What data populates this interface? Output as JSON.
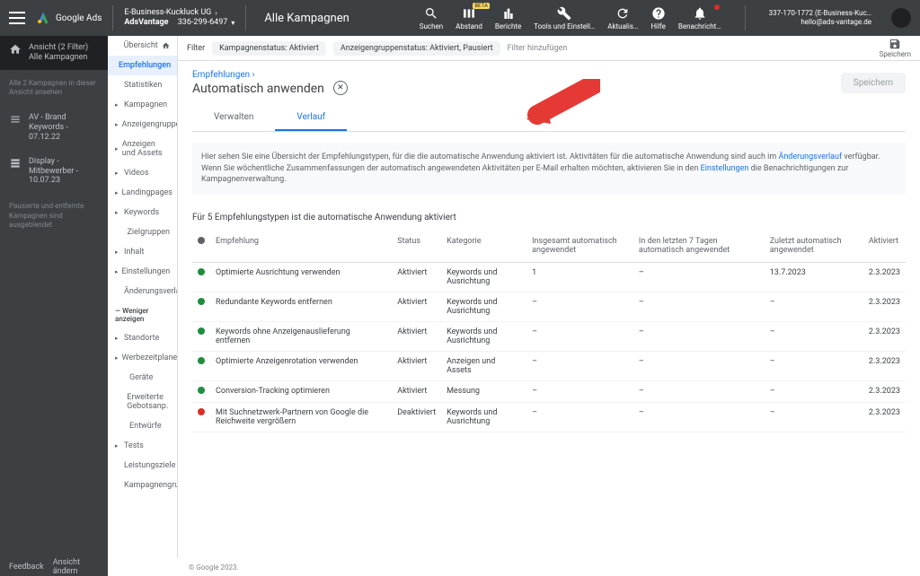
{
  "header": {
    "brand": "Google Ads",
    "account_line1": "E-Business-Kuckluck UG",
    "account_line2": "AdsVantage",
    "account_id": "336-299-6497",
    "campaign_title": "Alle Kampagnen",
    "icons": {
      "search": "Suchen",
      "distance": "Abstand",
      "reports": "Berichte",
      "tools": "Tools und Einstell…",
      "refresh": "Aktualis…",
      "help": "Hilfe",
      "notif": "Benachricht…"
    },
    "beta": "BETA",
    "account_right_line1": "337-170-1772 (E-Business-Kuc…",
    "account_right_line2": "hello@ads-vantage.de"
  },
  "sidebar1": {
    "view_title": "Ansicht (2 Filter)",
    "view_sub": "Alle Kampagnen",
    "view_note": "Alle 2 Kampagnen in dieser Ansicht ansehen",
    "items": [
      {
        "label": "AV - Brand Keywords - 07.12.22"
      },
      {
        "label": "Display - Mitbewerber - 10.07.23"
      }
    ],
    "paused_note": "Pausierte und entfernte Kampagnen sind ausgeblendet"
  },
  "sidebar2": {
    "items": [
      {
        "label": "Übersicht",
        "caret": false,
        "home": true
      },
      {
        "label": "Empfehlungen",
        "caret": false,
        "active": true
      },
      {
        "label": "Statistiken",
        "caret": false
      },
      {
        "label": "Kampagnen",
        "caret": true
      },
      {
        "label": "Anzeigengruppen",
        "caret": true
      },
      {
        "label": "Anzeigen und Assets",
        "caret": true
      },
      {
        "label": "Videos",
        "caret": true
      },
      {
        "label": "Landingpages",
        "caret": true
      },
      {
        "label": "Keywords",
        "caret": true
      },
      {
        "label": "Zielgruppen",
        "caret": false,
        "indent": true
      },
      {
        "label": "Inhalt",
        "caret": true
      },
      {
        "label": "Einstellungen",
        "caret": true
      },
      {
        "label": "Änderungsverlauf",
        "caret": false,
        "indent": true
      }
    ],
    "less": "Weniger anzeigen",
    "items2": [
      {
        "label": "Standorte",
        "caret": true
      },
      {
        "label": "Werbezeitplaner",
        "caret": true
      },
      {
        "label": "Geräte",
        "caret": false,
        "indent": true
      },
      {
        "label": "Erweiterte Gebotsanp.",
        "caret": false,
        "indent": true
      },
      {
        "label": "Entwürfe",
        "caret": false,
        "indent": true
      },
      {
        "label": "Tests",
        "caret": true
      },
      {
        "label": "Leistungsziele",
        "caret": false,
        "indent": true
      },
      {
        "label": "Kampagnengruppen",
        "caret": false,
        "indent": true
      }
    ]
  },
  "filterbar": {
    "label": "Filter",
    "chips": [
      "Kampagnenstatus: Aktiviert",
      "Anzeigengruppenstatus: Aktiviert, Pausiert"
    ],
    "add": "Filter hinzufügen",
    "save": "Speichern"
  },
  "page": {
    "breadcrumb": "Empfehlungen",
    "title": "Automatisch anwenden",
    "save_btn": "Speichern",
    "tabs": [
      "Verwalten",
      "Verlauf"
    ],
    "info_pre": "Hier sehen Sie eine Übersicht der Empfehlungstypen, für die die automatische Anwendung aktiviert ist. Aktivitäten für die automatische Anwendung sind auch im ",
    "info_link1": "Änderungsverlauf",
    "info_mid": " verfügbar. Wenn Sie wöchentliche Zusammenfassungen der automatisch angewendeten Aktivitäten per E-Mail erhalten möchten, aktivieren Sie in den ",
    "info_link2": "Einstellungen",
    "info_post": " die Benachrichtigungen zur Kampagnenverwaltung.",
    "subhead": "Für 5  Empfehlungstypen ist die automatische Anwendung aktiviert"
  },
  "table": {
    "headers": [
      "",
      "Empfehlung",
      "Status",
      "Kategorie",
      "Insgesamt automatisch angewendet",
      "In den letzten 7 Tagen automatisch angewendet",
      "Zuletzt automatisch angewendet",
      "Aktiviert"
    ],
    "rows": [
      {
        "dot": "g",
        "rec": "Optimierte Ausrichtung verwenden",
        "status": "Aktiviert",
        "cat": "Keywords und Ausrichtung",
        "total": "1",
        "last7": "–",
        "last": "13.7.2023",
        "act": "2.3.2023"
      },
      {
        "dot": "g",
        "rec": "Redundante Keywords entfernen",
        "status": "Aktiviert",
        "cat": "Keywords und Ausrichtung",
        "total": "–",
        "last7": "–",
        "last": "–",
        "act": "2.3.2023"
      },
      {
        "dot": "g",
        "rec": "Keywords ohne Anzeigenauslieferung entfernen",
        "status": "Aktiviert",
        "cat": "Keywords und Ausrichtung",
        "total": "–",
        "last7": "–",
        "last": "–",
        "act": "2.3.2023"
      },
      {
        "dot": "g",
        "rec": "Optimierte Anzeigenrotation verwenden",
        "status": "Aktiviert",
        "cat": "Anzeigen und Assets",
        "total": "–",
        "last7": "–",
        "last": "–",
        "act": "2.3.2023"
      },
      {
        "dot": "g",
        "rec": "Conversion-Tracking optimieren",
        "status": "Aktiviert",
        "cat": "Messung",
        "total": "–",
        "last7": "–",
        "last": "–",
        "act": "2.3.2023"
      },
      {
        "dot": "r",
        "rec": "Mit Suchnetzwerk-Partnern von Google die Reichweite vergrößern",
        "status": "Deaktiviert",
        "cat": "Keywords und Ausrichtung",
        "total": "–",
        "last7": "–",
        "last": "–",
        "act": "2.3.2023"
      }
    ]
  },
  "footer": {
    "feedback": "Feedback",
    "change_view": "Ansicht ändern",
    "copyright": "© Google 2023."
  }
}
